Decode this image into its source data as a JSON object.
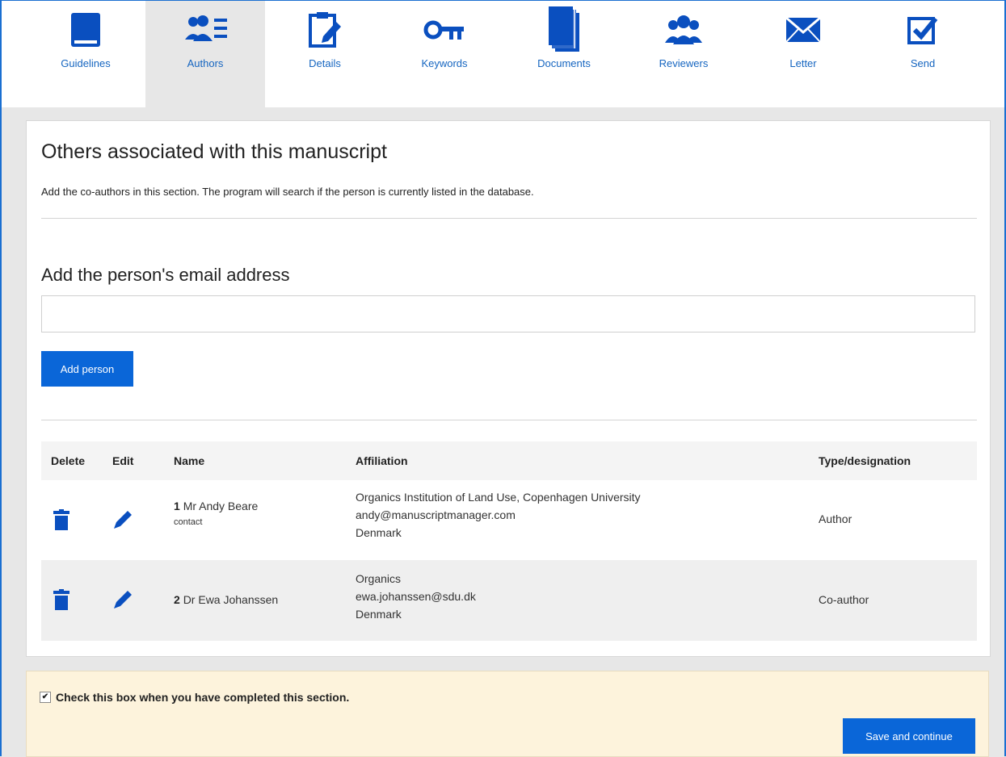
{
  "nav": {
    "tabs": [
      {
        "label": "Guidelines",
        "icon": "book-icon",
        "active": false
      },
      {
        "label": "Authors",
        "icon": "authors-icon",
        "active": true
      },
      {
        "label": "Details",
        "icon": "clipboard-edit-icon",
        "active": false
      },
      {
        "label": "Keywords",
        "icon": "key-icon",
        "active": false
      },
      {
        "label": "Documents",
        "icon": "documents-icon",
        "active": false
      },
      {
        "label": "Reviewers",
        "icon": "reviewers-icon",
        "active": false
      },
      {
        "label": "Letter",
        "icon": "envelope-icon",
        "active": false
      },
      {
        "label": "Send",
        "icon": "checkbox-send-icon",
        "active": false
      }
    ]
  },
  "section": {
    "title": "Others associated with this manuscript",
    "description": "Add the co-authors in this section. The program will search if the person is currently listed in the database.",
    "email_heading": "Add the person's email address",
    "email_value": "",
    "add_button": "Add person"
  },
  "table": {
    "headers": {
      "delete": "Delete",
      "edit": "Edit",
      "name": "Name",
      "affiliation": "Affiliation",
      "type": "Type/designation"
    },
    "rows": [
      {
        "num": "1",
        "name": "Mr Andy Beare",
        "role_note": "contact",
        "affiliation": "Organics Institution of Land Use, Copenhagen University",
        "email": "andy@manuscriptmanager.com",
        "country": "Denmark",
        "type": "Author"
      },
      {
        "num": "2",
        "name": "Dr Ewa Johanssen",
        "role_note": "",
        "affiliation": "Organics",
        "email": "ewa.johanssen@sdu.dk",
        "country": "Denmark",
        "type": "Co-author"
      }
    ]
  },
  "footer": {
    "checkbox_label": "Check this box when you have completed this section.",
    "checkbox_checked": true,
    "save_button": "Save and continue"
  },
  "colors": {
    "accent": "#0a66d8",
    "icon": "#0a4fbf",
    "active_tab": "#e7e7e7",
    "footer_bg": "#fdf3dc"
  }
}
